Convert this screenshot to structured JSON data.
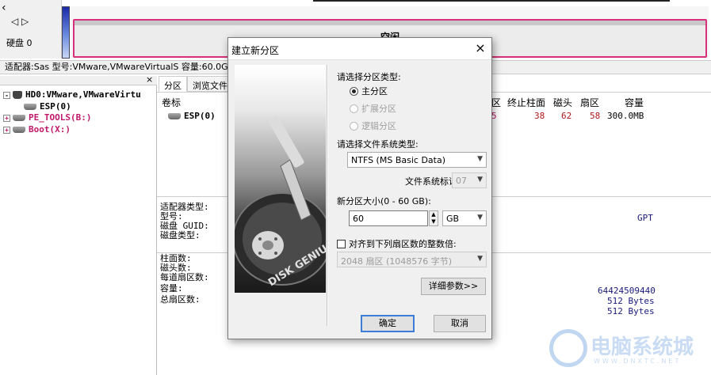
{
  "top": {
    "nav_back": "‹",
    "nav_arrows": "◁ ▷",
    "disk_label": "硬盘 0",
    "free_label": "空闲",
    "disk_info": "适配器:Sas  型号:VMware,VMwareVirtualS  容量:60.0GB(61440"
  },
  "tree": {
    "close_btn": "×",
    "items": [
      {
        "label": "HD0:VMware,VMwareVirtu",
        "expander": "-",
        "color": "#000000"
      },
      {
        "label": "ESP(0)",
        "expander": "",
        "color": "#000000"
      },
      {
        "label": "PE_TOOLS(B:)",
        "expander": "+",
        "color": "#c0186a"
      },
      {
        "label": "Boot(X:)",
        "expander": "+",
        "color": "#c0186a"
      }
    ]
  },
  "tabs": [
    "分区",
    "浏览文件"
  ],
  "grid": {
    "headers": {
      "volume": "卷标",
      "c_partial": "区",
      "end_cyl": "终止柱面",
      "head": "磁头",
      "sector": "扇区",
      "capacity": "容量"
    },
    "row": {
      "volume": "ESP(0)",
      "c_partial": "5",
      "end_cyl": "38",
      "head": "62",
      "sector": "58",
      "capacity": "300.0MB"
    }
  },
  "info": {
    "adapter_label": "适配器类型:",
    "model_label": "型号:",
    "guid_label": "磁盘 GUID:",
    "disktype_label": "磁盘类型:",
    "disktype_value": "GPT",
    "cyl_label": "柱面数:",
    "heads_label": "磁头数:",
    "spt_label": "每道扇区数:",
    "cap_label": "容量:",
    "total_sec_label": "总扇区数:",
    "cap_value": "64424509440",
    "bytes1": "512 Bytes",
    "bytes2": "512 Bytes"
  },
  "dialog": {
    "title": "建立新分区",
    "close": "×",
    "ptype_label": "请选择分区类型:",
    "radio_primary": "主分区",
    "radio_extended": "扩展分区",
    "radio_logical": "逻辑分区",
    "fs_label": "请选择文件系统类型:",
    "fs_value": "NTFS (MS Basic Data)",
    "fsid_label": "文件系统标识:",
    "fsid_value": "07",
    "size_label": "新分区大小(0 - 60 GB):",
    "size_value": "60",
    "size_unit": "GB",
    "align_label": "对齐到下列扇区数的整数倍:",
    "align_value": "2048 扇区 (1048576 字节)",
    "advanced_btn": "详细参数>>",
    "ok_btn": "确定",
    "cancel_btn": "取消",
    "image_text": "DISK GENIUS"
  },
  "watermark": {
    "text": "电脑系统城",
    "sub": "WWW.DNXTC.NET"
  },
  "colors": {
    "accent_pink": "#d8307a",
    "tree_pink": "#c0186a",
    "value_red": "#b01818"
  }
}
